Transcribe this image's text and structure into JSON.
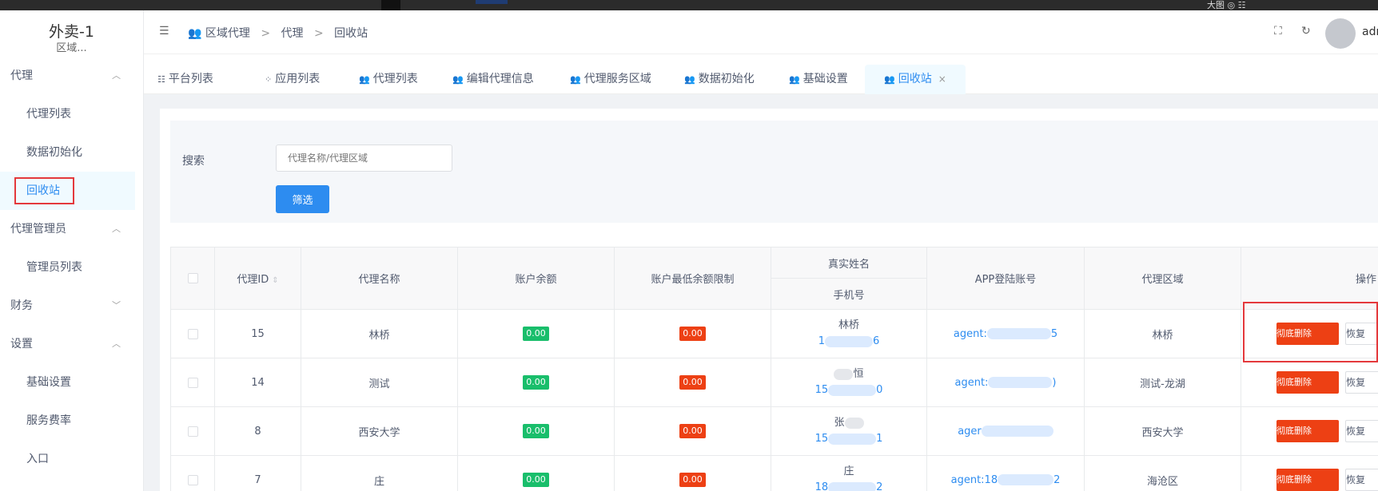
{
  "app": {
    "title": "外卖-1",
    "subtitle": "区域..."
  },
  "sidebar": {
    "groups": [
      {
        "label": "代理",
        "items": [
          "代理列表",
          "数据初始化",
          "回收站"
        ]
      },
      {
        "label": "代理管理员",
        "items": [
          "管理员列表"
        ]
      },
      {
        "label": "财务",
        "items": []
      },
      {
        "label": "设置",
        "items": [
          "基础设置",
          "服务费率",
          "入口"
        ]
      }
    ],
    "active": "回收站"
  },
  "header": {
    "breadcrumb": [
      "区域代理",
      "代理",
      "回收站"
    ],
    "username": "adm",
    "topstrip_text": "大图 ◎ ☷"
  },
  "tabs": [
    {
      "label": "平台列表"
    },
    {
      "label": "应用列表"
    },
    {
      "label": "代理列表"
    },
    {
      "label": "编辑代理信息"
    },
    {
      "label": "代理服务区域"
    },
    {
      "label": "数据初始化"
    },
    {
      "label": "基础设置"
    },
    {
      "label": "回收站",
      "active": true
    }
  ],
  "search": {
    "label": "搜索",
    "placeholder": "代理名称/代理区域",
    "button": "筛选"
  },
  "table": {
    "headers": {
      "id": "代理ID",
      "name": "代理名称",
      "balance": "账户余额",
      "min_balance": "账户最低余额限制",
      "real_name": "真实姓名",
      "phone": "手机号",
      "login": "APP登陆账号",
      "area": "代理区域",
      "ops": "操作"
    },
    "rows": [
      {
        "id": "15",
        "name": "林桥",
        "balance": "0.00",
        "min_balance": "0.00",
        "real_name": "林桥",
        "phone_start": "1",
        "phone_end": "6",
        "login_start": "agent:",
        "login_end": "5",
        "area": "林桥"
      },
      {
        "id": "14",
        "name": "测试",
        "balance": "0.00",
        "min_balance": "0.00",
        "real_name": "恒",
        "phone_start": "15",
        "phone_end": "0",
        "login_start": "agent:",
        "login_end": ")",
        "area": "测试-龙湖"
      },
      {
        "id": "8",
        "name": "西安大学",
        "balance": "0.00",
        "min_balance": "0.00",
        "real_name": "张",
        "phone_start": "15",
        "phone_end": "1",
        "login_start": "ager",
        "login_end": "",
        "area": "西安大学"
      },
      {
        "id": "7",
        "name": "庄",
        "balance": "0.00",
        "min_balance": "0.00",
        "real_name": "庄",
        "phone_start": "18",
        "phone_end": "2",
        "login_start": "agent:18",
        "login_end": "2",
        "area": "海沧区"
      }
    ],
    "delete_label": "彻底删除",
    "restore_label": "恢复"
  },
  "colors": {
    "accent": "#2d8cf0",
    "danger": "#ed4014",
    "success": "#19be6b",
    "highlight": "#e4393c"
  }
}
